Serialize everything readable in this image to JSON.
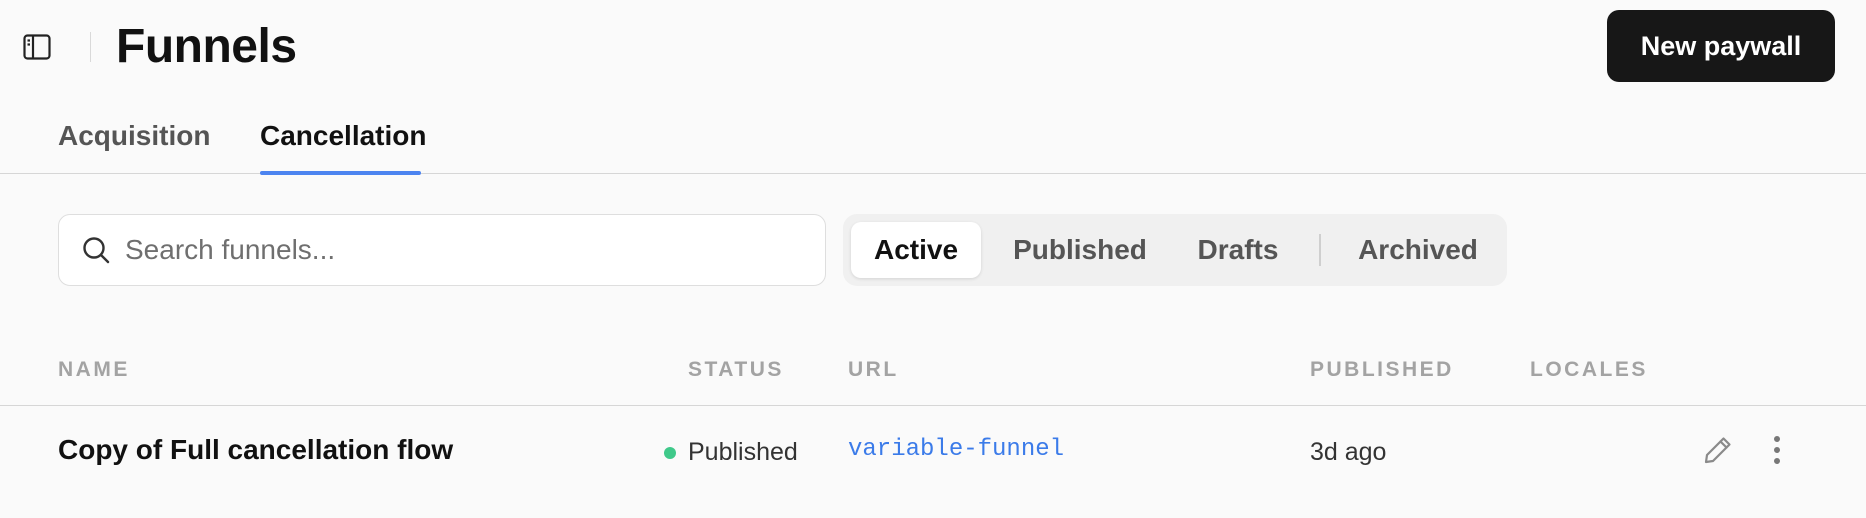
{
  "header": {
    "title": "Funnels",
    "new_button_label": "New paywall",
    "sidebar_toggle_icon": "sidebar-panel-icon"
  },
  "tabs": [
    {
      "label": "Acquisition",
      "active": false
    },
    {
      "label": "Cancellation",
      "active": true
    }
  ],
  "search": {
    "placeholder": "Search funnels...",
    "value": "",
    "icon": "search-icon"
  },
  "filters": [
    {
      "label": "Active",
      "active": true
    },
    {
      "label": "Published",
      "active": false
    },
    {
      "label": "Drafts",
      "active": false
    },
    {
      "label": "Archived",
      "active": false
    }
  ],
  "table": {
    "columns": [
      "NAME",
      "STATUS",
      "URL",
      "PUBLISHED",
      "LOCALES"
    ],
    "rows": [
      {
        "name": "Copy of Full cancellation flow",
        "status": "Published",
        "url": "variable-funnel",
        "published": "3d ago",
        "locales": ""
      }
    ]
  },
  "colors": {
    "accent": "#4c84f0",
    "status_published": "#3fc98a",
    "link": "#3b7be9",
    "primary_button": "#171717"
  }
}
